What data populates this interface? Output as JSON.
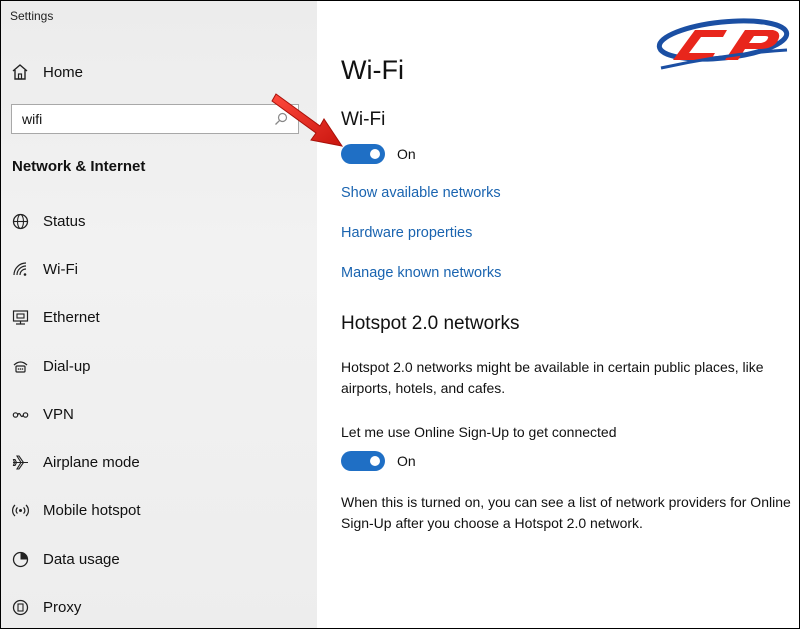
{
  "window": {
    "title": "Settings"
  },
  "sidebar": {
    "home_label": "Home",
    "search": {
      "value": "wifi"
    },
    "section_title": "Network & Internet",
    "items": [
      {
        "label": "Status",
        "icon": "globe-icon"
      },
      {
        "label": "Wi-Fi",
        "icon": "wifi-icon"
      },
      {
        "label": "Ethernet",
        "icon": "ethernet-icon"
      },
      {
        "label": "Dial-up",
        "icon": "dialup-icon"
      },
      {
        "label": "VPN",
        "icon": "vpn-icon"
      },
      {
        "label": "Airplane mode",
        "icon": "airplane-icon"
      },
      {
        "label": "Mobile hotspot",
        "icon": "hotspot-icon"
      },
      {
        "label": "Data usage",
        "icon": "data-usage-icon"
      },
      {
        "label": "Proxy",
        "icon": "proxy-icon"
      }
    ]
  },
  "main": {
    "page_title": "Wi-Fi",
    "wifi_section_title": "Wi-Fi",
    "wifi_toggle": {
      "state": "On",
      "on": true
    },
    "links": [
      "Show available networks",
      "Hardware properties",
      "Manage known networks"
    ],
    "hotspot_title": "Hotspot 2.0 networks",
    "hotspot_desc": "Hotspot 2.0 networks might be available in certain public places, like airports, hotels, and cafes.",
    "online_signup_label": "Let me use Online Sign-Up to get connected",
    "online_signup_toggle": {
      "state": "On",
      "on": true
    },
    "online_signup_desc": "When this is turned on, you can see a list of network providers for Online Sign-Up after you choose a Hotspot 2.0 network."
  },
  "colors": {
    "accent": "#1f6fc5",
    "link": "#1a64b0",
    "annotation_arrow": "#e8261c",
    "logo_red": "#e8261c",
    "logo_blue": "#1b4fa3"
  }
}
